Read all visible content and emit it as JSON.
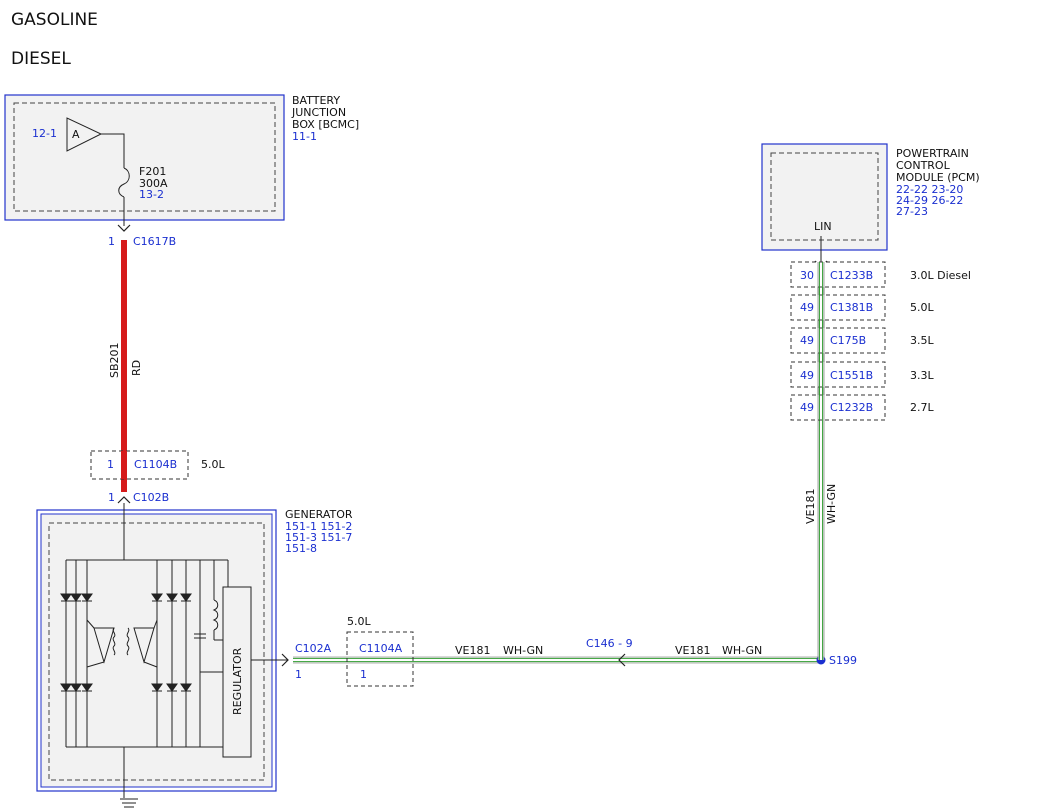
{
  "header": {
    "line1": "GASOLINE",
    "line2": "DIESEL"
  },
  "battery_box": {
    "title_lines": [
      "BATTERY",
      "JUNCTION",
      "BOX [BCMC]"
    ],
    "ref": "11-1",
    "source_ref": "12-1",
    "source_letter": "A",
    "fuse_name": "F201",
    "fuse_rating": "300A",
    "fuse_ref": "13-2"
  },
  "pcm": {
    "title_lines": [
      "POWERTRAIN",
      "CONTROL",
      "MODULE (PCM)"
    ],
    "refs": [
      "22-22 23-20",
      "24-29 26-22",
      "27-23"
    ],
    "pin_label": "LIN"
  },
  "pcm_connectors": [
    {
      "pin": "30",
      "name": "C1233B",
      "variant": "3.0L Diesel"
    },
    {
      "pin": "49",
      "name": "C1381B",
      "variant": "5.0L"
    },
    {
      "pin": "49",
      "name": "C175B",
      "variant": "3.5L"
    },
    {
      "pin": "49",
      "name": "C1551B",
      "variant": "3.3L"
    },
    {
      "pin": "49",
      "name": "C1232B",
      "variant": "2.7L"
    }
  ],
  "power_wire": {
    "top_pin": "1",
    "top_connector": "C1617B",
    "circuit": "SB201",
    "color": "RD",
    "inline_pin": "1",
    "inline_connector": "C1104B",
    "inline_variant": "5.0L",
    "bottom_pin": "1",
    "bottom_connector": "C102B"
  },
  "generator": {
    "title": "GENERATOR",
    "refs": [
      "151-1 151-2",
      "151-3 151-7",
      "151-8"
    ],
    "regulator_label": "REGULATOR"
  },
  "lin_wire": {
    "gen_connector": "C102A",
    "gen_pin": "1",
    "inline_variant": "5.0L",
    "inline_connector": "C1104A",
    "inline_pin": "1",
    "circuit": "VE181",
    "color": "WH-GN",
    "mid_connector": "C146 - 9",
    "splice": "S199",
    "vertical_circuit": "VE181",
    "vertical_color": "WH-GN"
  },
  "colors": {
    "red_wire": "#d51a1a",
    "green_wire": "#2e9b2e",
    "blue_text": "#1a2fd0",
    "box_border": "#2233cc",
    "box_fill": "#f2f2f2"
  }
}
